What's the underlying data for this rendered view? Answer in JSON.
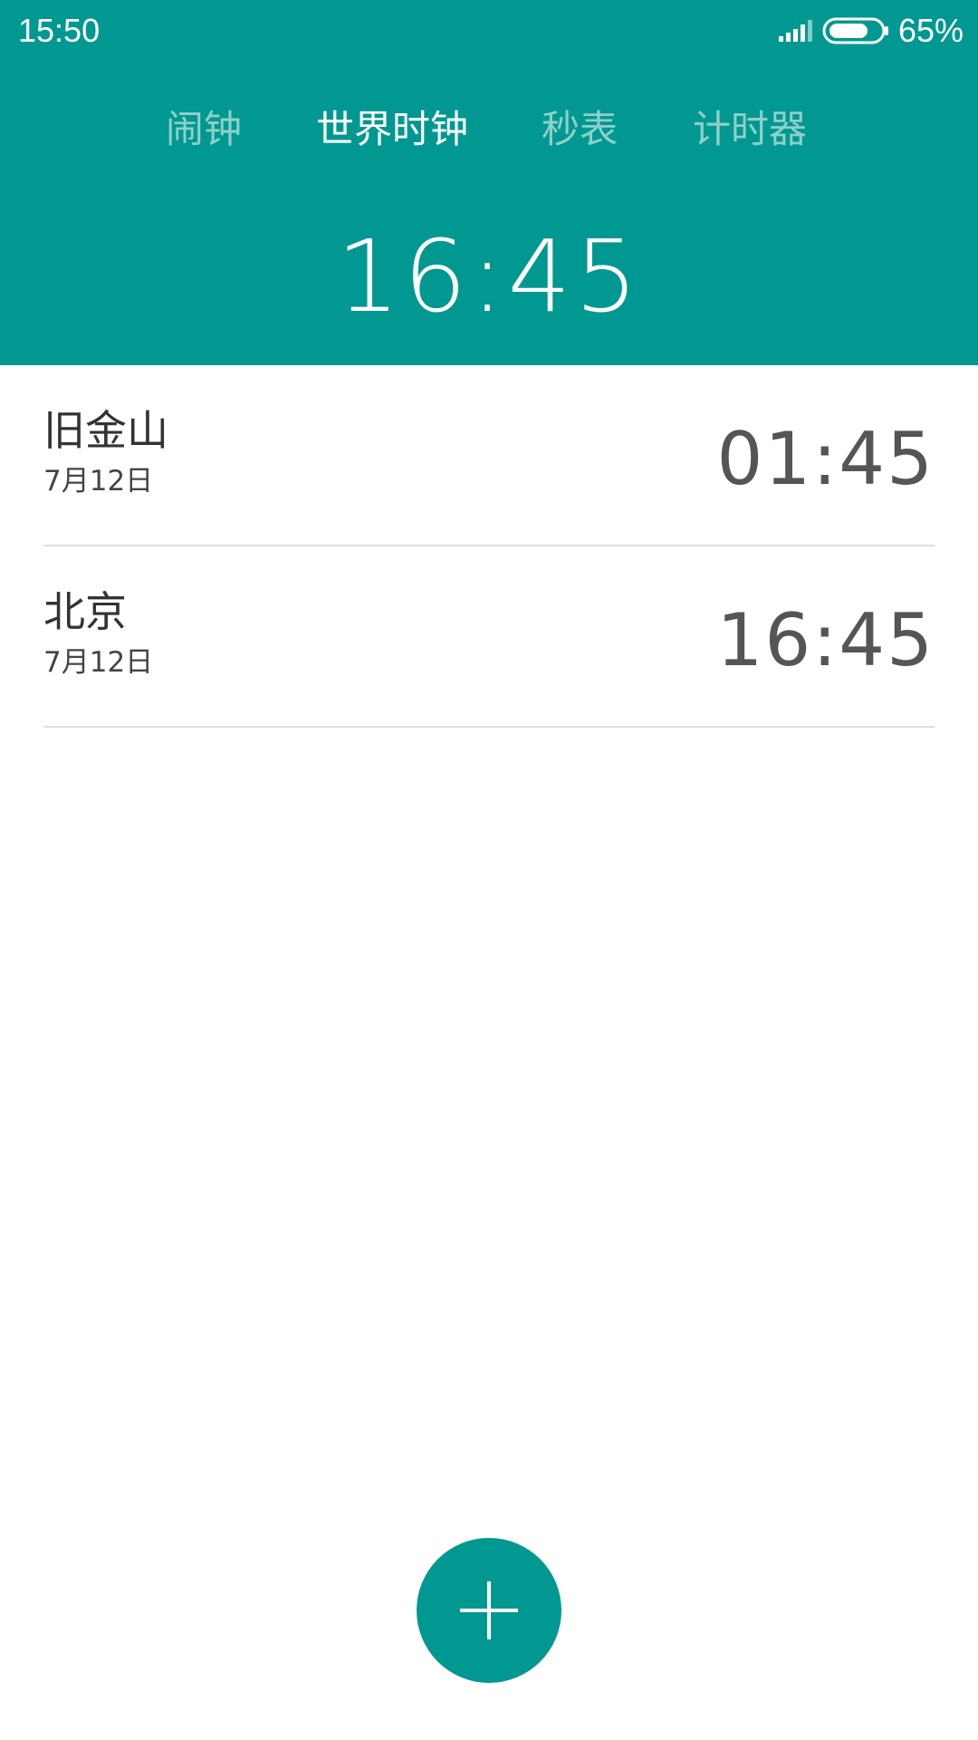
{
  "status_bar": {
    "time": "15:50",
    "battery_percent": "65%",
    "icons": [
      "signal-icon",
      "battery-icon"
    ]
  },
  "tabs": [
    {
      "label": "闹钟",
      "active": false
    },
    {
      "label": "世界时钟",
      "active": true
    },
    {
      "label": "秒表",
      "active": false
    },
    {
      "label": "计时器",
      "active": false
    }
  ],
  "local_time": "16:45",
  "cities": [
    {
      "name": "旧金山",
      "date": "7月12日",
      "time": "01:45"
    },
    {
      "name": "北京",
      "date": "7月12日",
      "time": "16:45"
    }
  ],
  "fab": {
    "icon": "plus-icon"
  },
  "colors": {
    "accent": "#009890",
    "tab_inactive": "#8fd0cb",
    "divider": "#dedede"
  }
}
